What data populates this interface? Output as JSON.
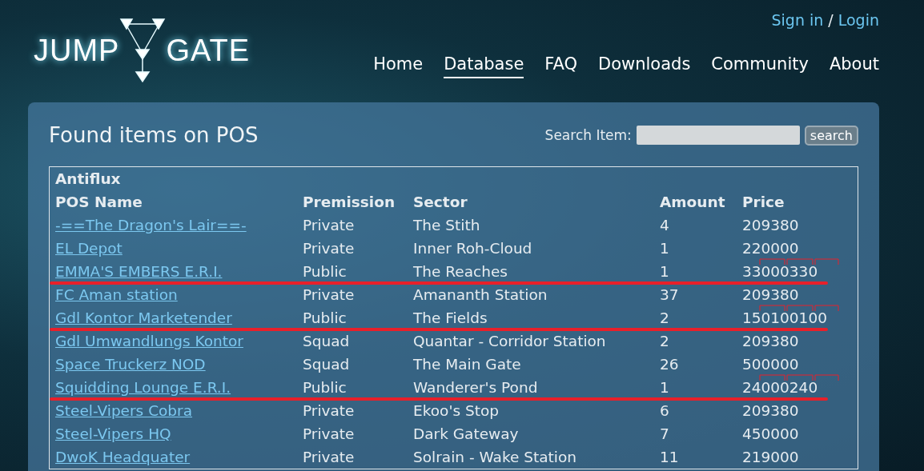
{
  "logo": {
    "left": "JUMP",
    "right": "GATE"
  },
  "account": {
    "sign_in": "Sign in",
    "separator": "/",
    "login": "Login"
  },
  "nav": [
    {
      "label": "Home",
      "selected": false
    },
    {
      "label": "Database",
      "selected": true
    },
    {
      "label": "FAQ",
      "selected": false
    },
    {
      "label": "Downloads",
      "selected": false
    },
    {
      "label": "Community",
      "selected": false
    },
    {
      "label": "About",
      "selected": false
    }
  ],
  "panel": {
    "title": "Found items on POS",
    "search": {
      "label": "Search Item:",
      "button": "search"
    }
  },
  "table": {
    "item": "Antiflux",
    "columns": [
      "POS Name",
      "Premission",
      "Sector",
      "Amount",
      "Price"
    ],
    "rows": [
      {
        "name": "-==The Dragon's Lair==-",
        "permission": "Private",
        "sector": "The Stith",
        "amount": "4",
        "price": "209380",
        "annotated": false
      },
      {
        "name": "EL Depot",
        "permission": "Private",
        "sector": "Inner Roh-Cloud",
        "amount": "1",
        "price": "220000",
        "annotated": false
      },
      {
        "name": "EMMA'S EMBERS E.R.I.",
        "permission": "Public",
        "sector": "The Reaches",
        "amount": "1",
        "price": "33000330",
        "annotated": true
      },
      {
        "name": "FC Aman station",
        "permission": "Private",
        "sector": "Amananth Station",
        "amount": "37",
        "price": "209380",
        "annotated": false
      },
      {
        "name": "Gdl Kontor Marketender",
        "permission": "Public",
        "sector": "The Fields",
        "amount": "2",
        "price": "150100100",
        "annotated": true
      },
      {
        "name": "Gdl Umwandlungs Kontor",
        "permission": "Squad",
        "sector": "Quantar - Corridor Station",
        "amount": "2",
        "price": "209380",
        "annotated": false
      },
      {
        "name": "Space Truckerz NOD",
        "permission": "Squad",
        "sector": "The Main Gate",
        "amount": "26",
        "price": "500000",
        "annotated": false
      },
      {
        "name": "Squidding Lounge E.R.I.",
        "permission": "Public",
        "sector": "Wanderer's Pond",
        "amount": "1",
        "price": "24000240",
        "annotated": true
      },
      {
        "name": "Steel-Vipers Cobra",
        "permission": "Private",
        "sector": "Ekoo's Stop",
        "amount": "6",
        "price": "209380",
        "annotated": false
      },
      {
        "name": "Steel-Vipers HQ",
        "permission": "Private",
        "sector": "Dark Gateway",
        "amount": "7",
        "price": "450000",
        "annotated": false
      },
      {
        "name": "DwoK Headquater",
        "permission": "Private",
        "sector": "Solrain - Wake Station",
        "amount": "11",
        "price": "219000",
        "annotated": false
      }
    ]
  }
}
